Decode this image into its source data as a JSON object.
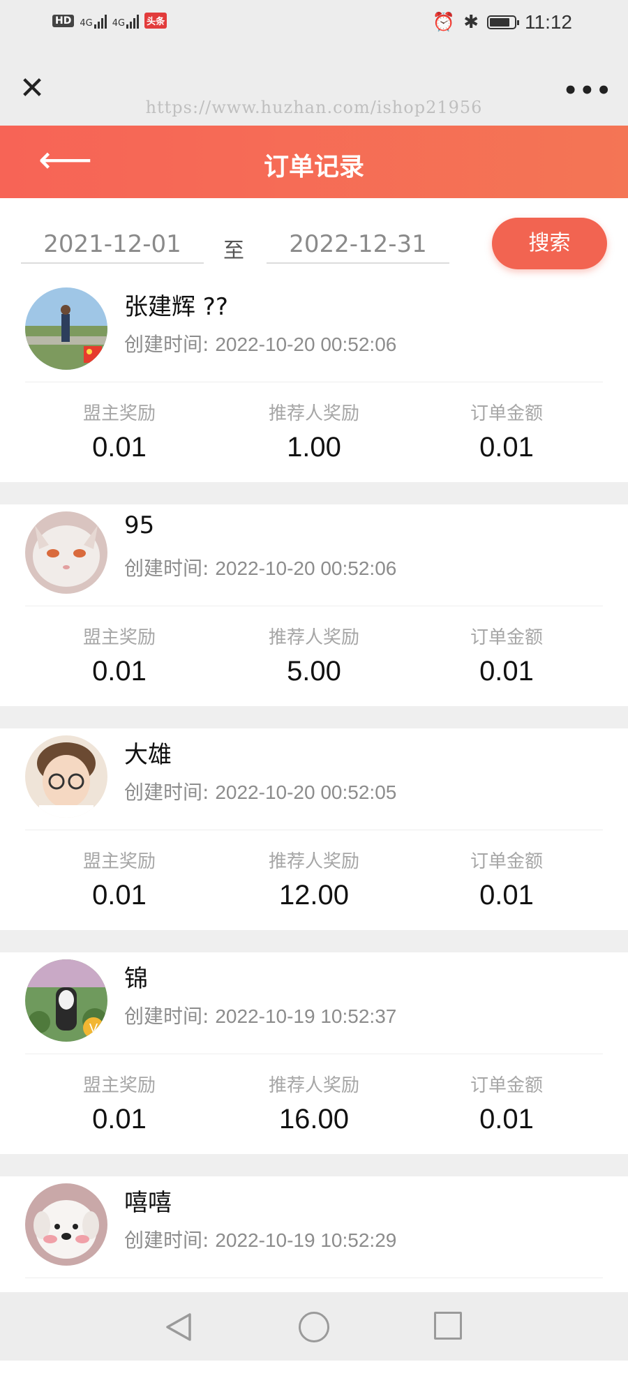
{
  "status_bar": {
    "hd": "HD",
    "network1": "4G",
    "network2": "4G",
    "app_badge": "头条",
    "time": "11:12"
  },
  "app_bar": {
    "watermark": "https://www.huzhan.com/ishop21956"
  },
  "header": {
    "title": "订单记录"
  },
  "filter": {
    "start_date": "2021-12-01",
    "to_label": "至",
    "end_date": "2022-12-31",
    "search_label": "搜索"
  },
  "labels": {
    "created_prefix": "创建时间:",
    "col1": "盟主奖励",
    "col2": "推荐人奖励",
    "col3": "订单金额"
  },
  "orders": [
    {
      "name": "张建辉 ??",
      "created": "2022-10-20 00:52:06",
      "leader_reward": "0.01",
      "referrer_reward": "1.00",
      "amount": "0.01"
    },
    {
      "name": "95",
      "created": "2022-10-20 00:52:06",
      "leader_reward": "0.01",
      "referrer_reward": "5.00",
      "amount": "0.01"
    },
    {
      "name": "大雄",
      "created": "2022-10-20 00:52:05",
      "leader_reward": "0.01",
      "referrer_reward": "12.00",
      "amount": "0.01"
    },
    {
      "name": "锦",
      "created": "2022-10-19 10:52:37",
      "leader_reward": "0.01",
      "referrer_reward": "16.00",
      "amount": "0.01"
    },
    {
      "name": "嘻嘻",
      "created": "2022-10-19 10:52:29",
      "leader_reward": "",
      "referrer_reward": "",
      "amount": ""
    }
  ]
}
